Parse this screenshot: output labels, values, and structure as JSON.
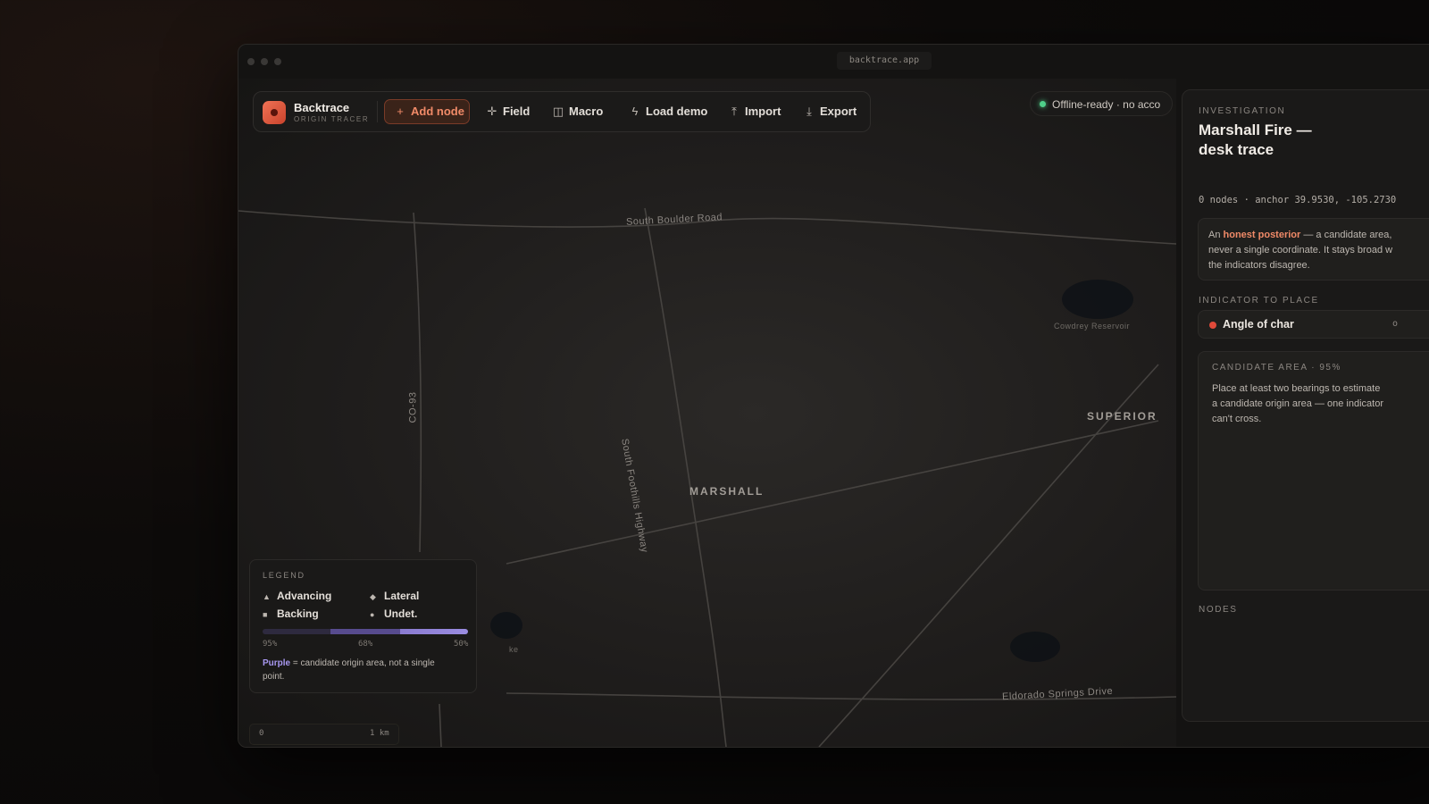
{
  "window": {
    "url": "backtrace.app"
  },
  "toolbar": {
    "brand_name": "Backtrace",
    "brand_subtitle": "ORIGIN TRACER",
    "buttons": [
      {
        "label": "Add node",
        "icon": "plus-icon",
        "glyph": "+"
      },
      {
        "label": "Field",
        "icon": "crosshair-icon",
        "glyph": "✛"
      },
      {
        "label": "Macro",
        "icon": "panel-icon",
        "glyph": "◫"
      },
      {
        "label": "Load demo",
        "icon": "bolt-icon",
        "glyph": "ϟ"
      },
      {
        "label": "Import",
        "icon": "upload-icon",
        "glyph": "⤒"
      },
      {
        "label": "Export",
        "icon": "download-icon",
        "glyph": "⤓"
      }
    ]
  },
  "status": {
    "text": "Offline-ready · no acco",
    "color": "#4fd08a"
  },
  "map": {
    "roads": [
      "South Boulder Road",
      "CO-93",
      "South Foothills Highway",
      "Eldorado Springs Drive"
    ],
    "places": [
      "MARSHALL",
      "SUPERIOR"
    ],
    "features": [
      "Cowdrey Reservoir",
      "ke"
    ]
  },
  "legend": {
    "title": "LEGEND",
    "items": [
      {
        "label": "Advancing",
        "icon": "triangle-icon",
        "glyph": "▲"
      },
      {
        "label": "Lateral",
        "icon": "diamond-icon",
        "glyph": "◆"
      },
      {
        "label": "Backing",
        "icon": "square-icon",
        "glyph": "■"
      },
      {
        "label": "Undet.",
        "icon": "circle-icon",
        "glyph": "●"
      }
    ],
    "ticks": [
      "95%",
      "68%",
      "50%"
    ],
    "note_emph": "Purple",
    "note_rest": " = candidate origin area, not a single point."
  },
  "scale": {
    "start": "0",
    "end": "1 km"
  },
  "panel": {
    "caption": "INVESTIGATION",
    "title": "Marshall Fire — desk trace",
    "meta": "0 nodes · anchor 39.9530, -105.2730",
    "intro_pre": "An ",
    "intro_emph": "honest posterior",
    "intro_line1_rest": " — a candidate area,",
    "intro_line2": "never a single coordinate. It stays broad w",
    "intro_line3": "the indicators disagree.",
    "indicator_caption": "INDICATOR TO PLACE",
    "indicator_label": "Angle of char",
    "indicator_trailing": "o",
    "candidate_caption": "CANDIDATE AREA · 95%",
    "candidate_line1": "Place at least two bearings to estimate",
    "candidate_line2": "a candidate origin area — one indicator",
    "candidate_line3": "can't cross.",
    "nodes_caption": "NODES"
  }
}
